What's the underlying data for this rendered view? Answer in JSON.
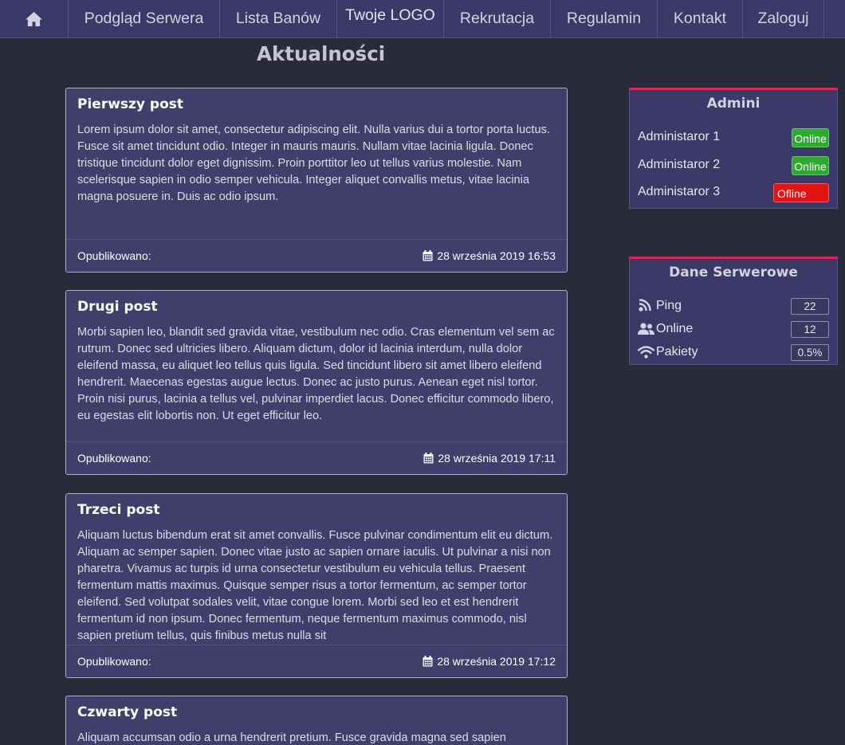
{
  "nav": {
    "home_icon": "home-icon",
    "items": [
      {
        "label": "Podgląd Serwera"
      },
      {
        "label": "Lista Banów"
      },
      {
        "label": "Twoje LOGO"
      },
      {
        "label": "Rekrutacja"
      },
      {
        "label": "Regulamin"
      },
      {
        "label": "Kontakt"
      },
      {
        "label": "Zaloguj"
      }
    ]
  },
  "news": {
    "title": "Aktualności",
    "posts": [
      {
        "title": "Pierwszy post",
        "body": "Lorem ipsum dolor sit amet, consectetur adipiscing elit. Nulla varius dui a tortor porta luctus. Fusce sit amet tincidunt odio. Integer in mauris mauris. Nullam vitae lacinia ligula. Donec tristique tincidunt dolor eget dignissim. Proin porttitor leo ut tellus varius molestie. Nam scelerisque sapien in odio semper vehicula. Integer aliquet convallis metus, vitae lacinia magna posuere in. Duis ac odio ipsum.",
        "published_label": "Opublikowano:",
        "date": "28 września 2019 16:53"
      },
      {
        "title": "Drugi post",
        "body": "Morbi sapien leo, blandit sed gravida vitae, vestibulum nec odio. Cras elementum vel sem ac rutrum. Donec sed ultricies libero. Aliquam dictum, dolor id lacinia interdum, nulla dolor eleifend massa, eu aliquet leo tellus quis ligula. Sed tincidunt libero sit amet libero eleifend hendrerit. Maecenas egestas augue lectus. Donec ac justo purus. Aenean eget nisl tortor. Proin nisi purus, lacinia a tellus vel, pulvinar imperdiet lacus. Donec efficitur commodo libero, eu egestas elit lobortis non. Ut eget efficitur leo.",
        "published_label": "Opublikowano:",
        "date": "28 września 2019 17:11"
      },
      {
        "title": "Trzeci post",
        "body": "Aliquam luctus bibendum erat sit amet convallis. Fusce pulvinar condimentum elit eu dictum. Aliquam ac semper sapien. Donec vitae justo ac sapien ornare iaculis. Ut pulvinar a nisi non pharetra. Vivamus ac turpis id urna consectetur vestibulum eu vehicula tellus. Praesent fermentum mattis maximus. Quisque semper risus a tortor fermentum, ac semper tortor eleifend. Sed volutpat sodales velit, vitae congue lorem. Morbi sed leo et est hendrerit fermentum id non ipsum. Donec fermentum, neque fermentum maximus commodo, nisl sapien pretium tellus, quis finibus metus nulla sit",
        "published_label": "Opublikowano:",
        "date": "28 września 2019 17:12"
      },
      {
        "title": "Czwarty post",
        "body": "Aliquam accumsan odio a urna hendrerit pretium. Fusce gravida magna sed sapien"
      }
    ]
  },
  "admins": {
    "title": "Admini",
    "items": [
      {
        "name": "Administaror 1",
        "status": "Online"
      },
      {
        "name": "Administaror 2",
        "status": "Online"
      },
      {
        "name": "Administaror 3",
        "status": "Ofline"
      }
    ]
  },
  "server": {
    "title": "Dane Serwerowe",
    "stats": [
      {
        "label": "Ping",
        "value": "22",
        "icon": "signal-icon"
      },
      {
        "label": "Online",
        "value": "12",
        "icon": "users-icon"
      },
      {
        "label": "Pakiety",
        "value": "0.5%",
        "icon": "wifi-icon"
      }
    ]
  },
  "colors": {
    "background": "#292a3a",
    "navbar": "#3c3867",
    "card": "#423e6b",
    "accent": "#d8275a",
    "online": "#2eaa32",
    "offline": "#e21313"
  }
}
